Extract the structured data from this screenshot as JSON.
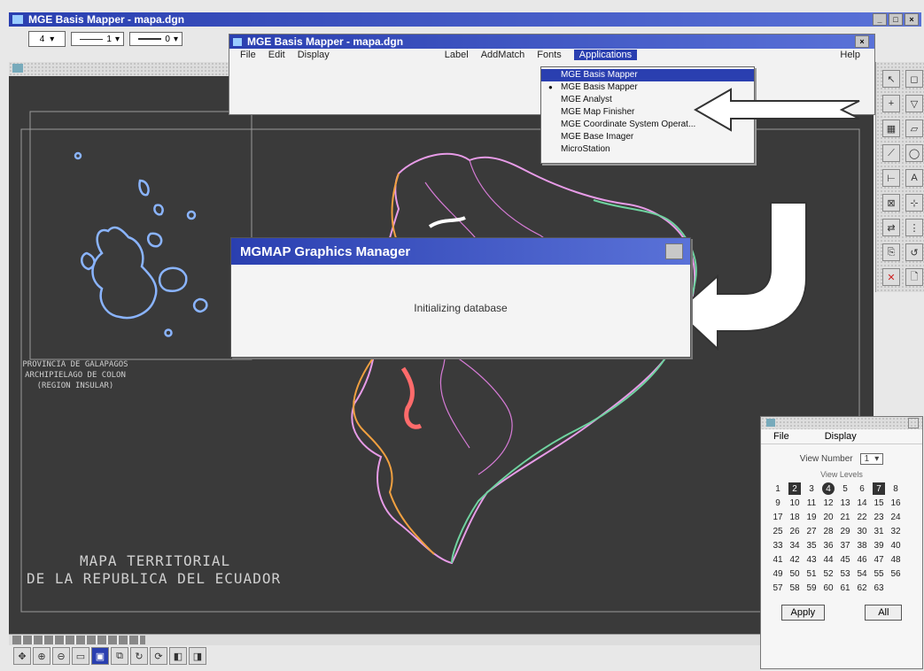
{
  "outer_window": {
    "title": "MGE Basis Mapper - mapa.dgn",
    "controls": [
      "_",
      "□",
      "×"
    ]
  },
  "toolbar": {
    "field1": "4",
    "field2": "1",
    "field3": "0"
  },
  "inner_window": {
    "title": "MGE Basis Mapper - mapa.dgn",
    "menu": [
      "File",
      "Edit",
      "Display",
      "Label",
      "AddMatch",
      "Fonts",
      "Applications",
      "Help"
    ]
  },
  "applications_menu": {
    "items": [
      {
        "label": "MGE Basis Mapper",
        "selected": true,
        "bullet": false
      },
      {
        "label": "MGE Basis Mapper",
        "selected": false,
        "bullet": true
      },
      {
        "label": "MGE Analyst",
        "selected": false,
        "bullet": false
      },
      {
        "label": "MGE Map Finisher",
        "selected": false,
        "bullet": false
      },
      {
        "label": "MGE Coordinate System Operat...",
        "selected": false,
        "bullet": false
      },
      {
        "label": "MGE Base Imager",
        "selected": false,
        "bullet": false
      },
      {
        "label": "MicroStation",
        "selected": false,
        "bullet": false
      }
    ]
  },
  "dialog": {
    "title": "MGMAP Graphics Manager",
    "message": "Initializing database"
  },
  "map": {
    "inset_caption": [
      "PROVINCIA DE GALAPAGOS",
      "ARCHIPIELAGO DE COLON",
      "(REGION INSULAR)"
    ],
    "map_title_line1": "MAPA TERRITORIAL",
    "map_title_line2": "DE LA REPUBLICA DEL ECUADOR"
  },
  "view_panel": {
    "menu": [
      "File",
      "Display"
    ],
    "view_number_label": "View Number",
    "view_number_value": "1",
    "subtitle": "View Levels",
    "levels": [
      [
        "1",
        "2",
        "3",
        "4",
        "5",
        "6",
        "7",
        "8"
      ],
      [
        "9",
        "10",
        "11",
        "12",
        "13",
        "14",
        "15",
        "16"
      ],
      [
        "17",
        "18",
        "19",
        "20",
        "21",
        "22",
        "23",
        "24"
      ],
      [
        "25",
        "26",
        "27",
        "28",
        "29",
        "30",
        "31",
        "32"
      ],
      [
        "33",
        "34",
        "35",
        "36",
        "37",
        "38",
        "39",
        "40"
      ],
      [
        "41",
        "42",
        "43",
        "44",
        "45",
        "46",
        "47",
        "48"
      ],
      [
        "49",
        "50",
        "51",
        "52",
        "53",
        "54",
        "55",
        "56"
      ],
      [
        "57",
        "58",
        "59",
        "60",
        "61",
        "62",
        "63",
        ""
      ]
    ],
    "highlight_square": [
      "2",
      "7"
    ],
    "highlight_round": [
      "4"
    ],
    "apply_label": "Apply",
    "all_label": "All"
  },
  "colors": {
    "accent": "#2a3fb0",
    "map_bg": "#3a3a3a",
    "menu_highlight": "#2a3fb0"
  }
}
